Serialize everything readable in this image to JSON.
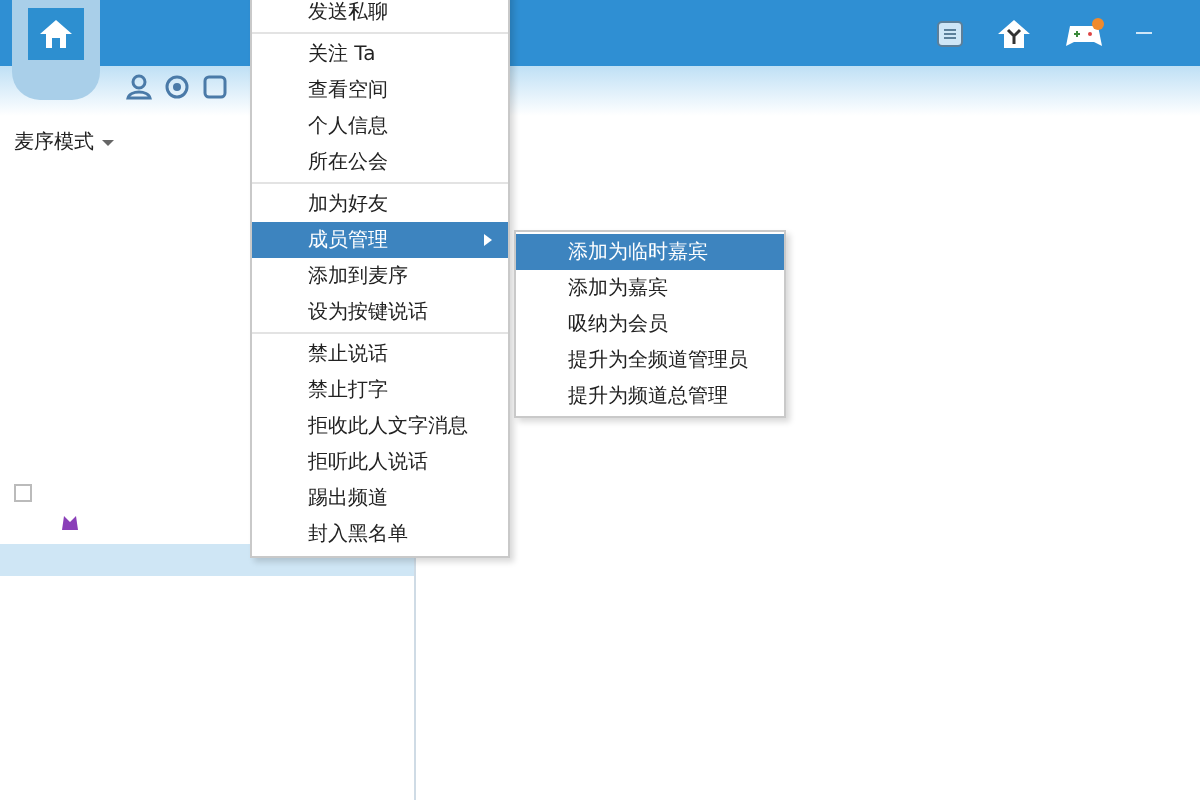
{
  "toolbar": {
    "mode_dropdown": "麦序模式"
  },
  "context_menu": {
    "groups": [
      [
        {
          "label": "发送私聊",
          "selected": false,
          "submenu": false
        }
      ],
      [
        {
          "label": "关注 Ta",
          "selected": false,
          "submenu": false
        },
        {
          "label": "查看空间",
          "selected": false,
          "submenu": false
        },
        {
          "label": "个人信息",
          "selected": false,
          "submenu": false
        },
        {
          "label": "所在公会",
          "selected": false,
          "submenu": false
        }
      ],
      [
        {
          "label": "加为好友",
          "selected": false,
          "submenu": false
        },
        {
          "label": "成员管理",
          "selected": true,
          "submenu": true
        },
        {
          "label": "添加到麦序",
          "selected": false,
          "submenu": false
        },
        {
          "label": "设为按键说话",
          "selected": false,
          "submenu": false
        }
      ],
      [
        {
          "label": "禁止说话",
          "selected": false,
          "submenu": false
        },
        {
          "label": "禁止打字",
          "selected": false,
          "submenu": false
        },
        {
          "label": "拒收此人文字消息",
          "selected": false,
          "submenu": false
        },
        {
          "label": "拒听此人说话",
          "selected": false,
          "submenu": false
        },
        {
          "label": "踢出频道",
          "selected": false,
          "submenu": false
        },
        {
          "label": "封入黑名单",
          "selected": false,
          "submenu": false
        }
      ]
    ]
  },
  "submenu": {
    "items": [
      {
        "label": "添加为临时嘉宾",
        "selected": true
      },
      {
        "label": "添加为嘉宾",
        "selected": false
      },
      {
        "label": "吸纳为会员",
        "selected": false
      },
      {
        "label": "提升为全频道管理员",
        "selected": false
      },
      {
        "label": "提升为频道总管理",
        "selected": false
      }
    ]
  }
}
